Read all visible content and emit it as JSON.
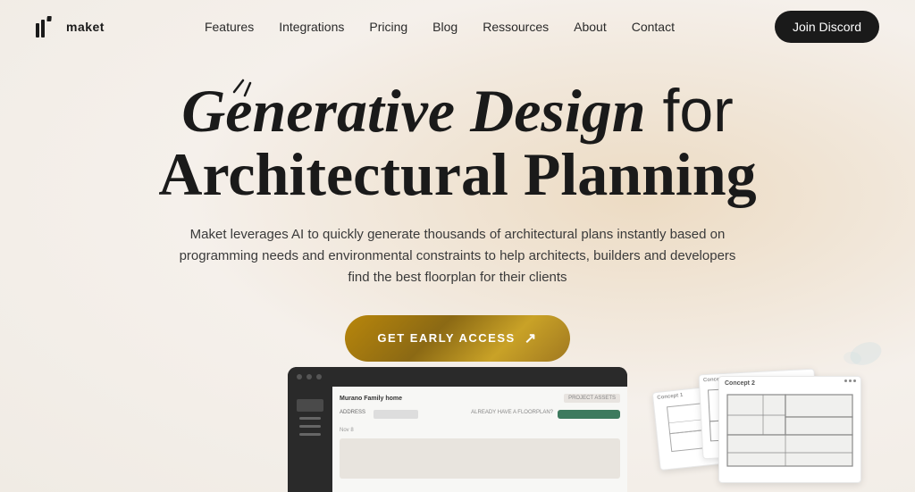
{
  "nav": {
    "logo_text": "maket",
    "links": [
      {
        "label": "Features",
        "id": "features"
      },
      {
        "label": "Integrations",
        "id": "integrations"
      },
      {
        "label": "Pricing",
        "id": "pricing"
      },
      {
        "label": "Blog",
        "id": "blog"
      },
      {
        "label": "Ressources",
        "id": "ressources"
      },
      {
        "label": "About",
        "id": "about"
      },
      {
        "label": "Contact",
        "id": "contact"
      }
    ],
    "cta_label": "Join Discord"
  },
  "hero": {
    "title_line1_italic": "Generative Design",
    "title_line1_rest": " for",
    "title_line2": "Architectural Planning",
    "subtitle": "Maket leverages AI to quickly generate thousands of architectural plans instantly based on programming needs and environmental constraints to help architects, builders and developers find the best floorplan for their clients",
    "cta_label": "GET EARLY ACCESS",
    "cta_arrow": "↗"
  },
  "colors": {
    "background": "#f0ebe4",
    "dark": "#1a1a1a",
    "cta_bg": "#8B6914",
    "discord_btn": "#1a1a1a"
  }
}
